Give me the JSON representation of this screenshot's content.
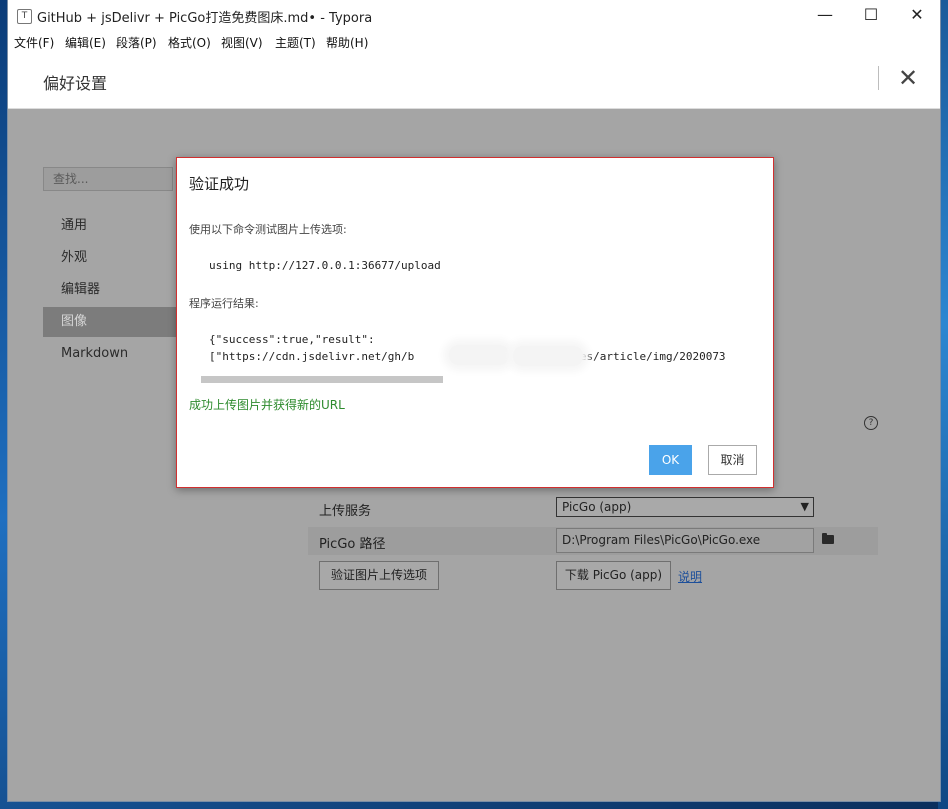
{
  "window": {
    "title": "GitHub + jsDelivr + PicGo打造免费图床.md• - Typora",
    "app_icon_letter": "T",
    "minimize_glyph": "—",
    "maximize_glyph": "☐",
    "close_glyph": "✕"
  },
  "menu": [
    "文件(F)",
    "编辑(E)",
    "段落(P)",
    "格式(O)",
    "视图(V)",
    "主题(T)",
    "帮助(H)"
  ],
  "preferences": {
    "title": "偏好设置",
    "close_glyph": "✕",
    "search_placeholder": "查找...",
    "sidebar": [
      {
        "label": "通用",
        "active": false
      },
      {
        "label": "外观",
        "active": false
      },
      {
        "label": "编辑器",
        "active": false
      },
      {
        "label": "图像",
        "active": true
      },
      {
        "label": "Markdown",
        "active": false
      }
    ],
    "help_glyph": "?",
    "image_settings": {
      "upload_service_label": "上传服务",
      "upload_service_value": "PicGo (app)",
      "picgo_path_label": "PicGo 路径",
      "picgo_path_value": "D:\\Program Files\\PicGo\\PicGo.exe",
      "verify_button": "验证图片上传选项",
      "download_button": "下载 PicGo (app)",
      "help_link": "说明"
    }
  },
  "dialog": {
    "title": "验证成功",
    "intro": "使用以下命令测试图片上传选项:",
    "command": "using http://127.0.0.1:36677/upload",
    "result_label": "程序运行结果:",
    "result_line1": "{\"success\":true,\"result\":",
    "result_line2": "[\"https://cdn.jsdelivr.net/gh/b         e/         sources/article/img/2020073",
    "success_text": "成功上传图片并获得新的URL",
    "ok_button": "OK",
    "cancel_button": "取消"
  },
  "colors": {
    "dialog_border": "#d12f2f",
    "ok_button": "#4aa3ea",
    "success_text": "#2e8b2e",
    "overlay": "#a5a5a5"
  }
}
